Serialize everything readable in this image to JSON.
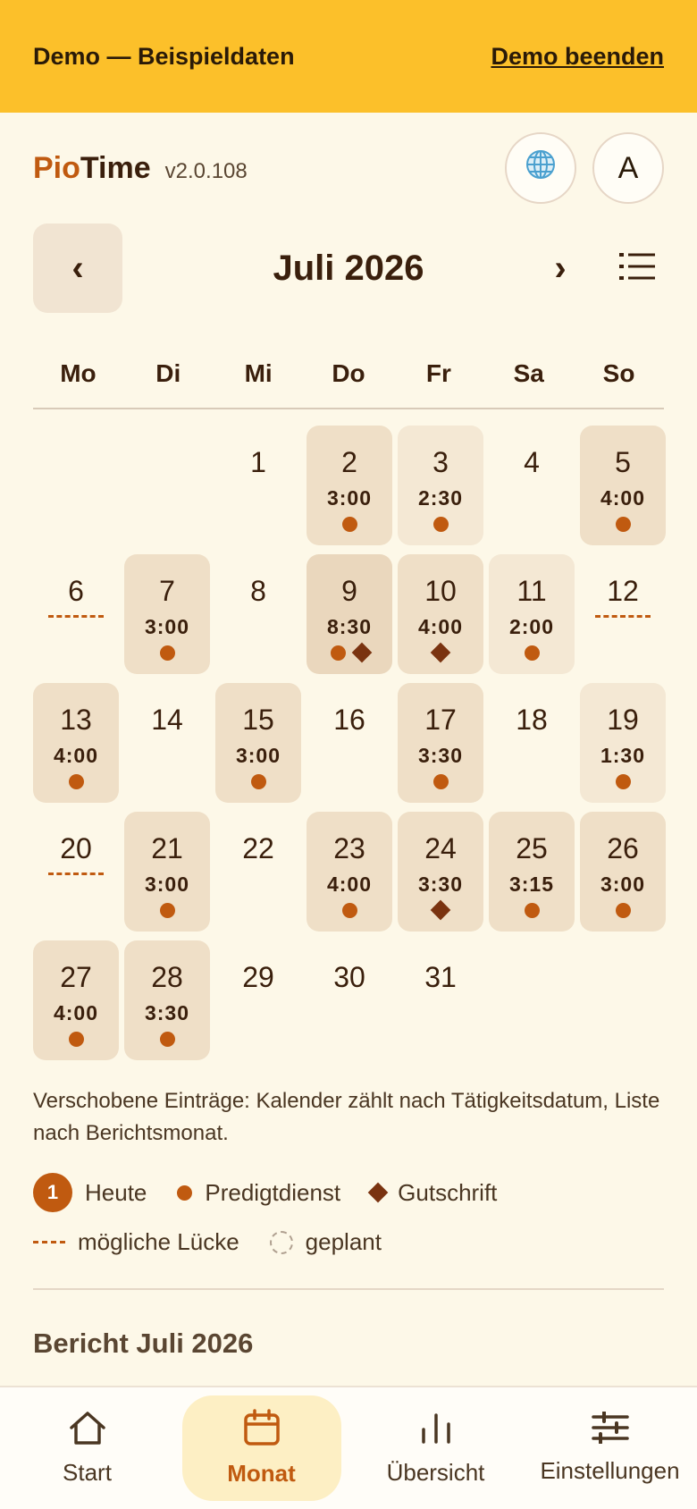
{
  "banner": {
    "text": "Demo — Beispieldaten",
    "end_label": "Demo beenden"
  },
  "header": {
    "brand_pio": "Pio",
    "brand_time": "Time",
    "version": "v2.0.108",
    "avatar_letter": "A",
    "language_icon": "globe-icon"
  },
  "calendar": {
    "month_title": "Juli 2026",
    "prev_label": "‹",
    "next_label": "›",
    "weekdays": [
      "Mo",
      "Di",
      "Mi",
      "Do",
      "Fr",
      "Sa",
      "So"
    ],
    "leading_empty_days": 2,
    "days": [
      {
        "day": "1",
        "hours": "",
        "marks": [],
        "shade": ""
      },
      {
        "day": "2",
        "hours": "3:00",
        "marks": [
          "dot"
        ],
        "shade": "c1"
      },
      {
        "day": "3",
        "hours": "2:30",
        "marks": [
          "dot"
        ],
        "shade": "c2"
      },
      {
        "day": "4",
        "hours": "",
        "marks": [],
        "shade": ""
      },
      {
        "day": "5",
        "hours": "4:00",
        "marks": [
          "dot"
        ],
        "shade": "c1"
      },
      {
        "day": "6",
        "hours": "",
        "marks": [
          "gap"
        ],
        "shade": ""
      },
      {
        "day": "7",
        "hours": "3:00",
        "marks": [
          "dot"
        ],
        "shade": "c1"
      },
      {
        "day": "8",
        "hours": "",
        "marks": [],
        "shade": ""
      },
      {
        "day": "9",
        "hours": "8:30",
        "marks": [
          "dot",
          "diamond"
        ],
        "shade": "c3"
      },
      {
        "day": "10",
        "hours": "4:00",
        "marks": [
          "diamond"
        ],
        "shade": "c1"
      },
      {
        "day": "11",
        "hours": "2:00",
        "marks": [
          "dot"
        ],
        "shade": "c2"
      },
      {
        "day": "12",
        "hours": "",
        "marks": [
          "gap"
        ],
        "shade": ""
      },
      {
        "day": "13",
        "hours": "4:00",
        "marks": [
          "dot"
        ],
        "shade": "c1"
      },
      {
        "day": "14",
        "hours": "",
        "marks": [],
        "shade": ""
      },
      {
        "day": "15",
        "hours": "3:00",
        "marks": [
          "dot"
        ],
        "shade": "c1"
      },
      {
        "day": "16",
        "hours": "",
        "marks": [],
        "shade": ""
      },
      {
        "day": "17",
        "hours": "3:30",
        "marks": [
          "dot"
        ],
        "shade": "c1"
      },
      {
        "day": "18",
        "hours": "",
        "marks": [],
        "shade": ""
      },
      {
        "day": "19",
        "hours": "1:30",
        "marks": [
          "dot"
        ],
        "shade": "c2"
      },
      {
        "day": "20",
        "hours": "",
        "marks": [
          "gap"
        ],
        "shade": ""
      },
      {
        "day": "21",
        "hours": "3:00",
        "marks": [
          "dot"
        ],
        "shade": "c1"
      },
      {
        "day": "22",
        "hours": "",
        "marks": [],
        "shade": ""
      },
      {
        "day": "23",
        "hours": "4:00",
        "marks": [
          "dot"
        ],
        "shade": "c1"
      },
      {
        "day": "24",
        "hours": "3:30",
        "marks": [
          "diamond"
        ],
        "shade": "c1"
      },
      {
        "day": "25",
        "hours": "3:15",
        "marks": [
          "dot"
        ],
        "shade": "c1"
      },
      {
        "day": "26",
        "hours": "3:00",
        "marks": [
          "dot"
        ],
        "shade": "c1"
      },
      {
        "day": "27",
        "hours": "4:00",
        "marks": [
          "dot"
        ],
        "shade": "c1"
      },
      {
        "day": "28",
        "hours": "3:30",
        "marks": [
          "dot"
        ],
        "shade": "c1"
      },
      {
        "day": "29",
        "hours": "",
        "marks": [],
        "shade": ""
      },
      {
        "day": "30",
        "hours": "",
        "marks": [],
        "shade": ""
      },
      {
        "day": "31",
        "hours": "",
        "marks": [],
        "shade": ""
      }
    ]
  },
  "note": "Verschobene Einträge: Kalender zählt nach Tätigkeitsdatum, Liste nach Berichtsmonat.",
  "legend": {
    "today_badge": "1",
    "today": "Heute",
    "service": "Predigtdienst",
    "credit": "Gutschrift",
    "gap": "mögliche Lücke",
    "planned": "geplant"
  },
  "report": {
    "title": "Bericht Juli 2026"
  },
  "bottom_nav": {
    "start": "Start",
    "month": "Monat",
    "overview": "Übersicht",
    "settings": "Einstellungen"
  },
  "colors": {
    "banner": "#fcc02a",
    "accent": "#c05a10",
    "credit": "#7a3310",
    "background": "#fdf8e8"
  }
}
